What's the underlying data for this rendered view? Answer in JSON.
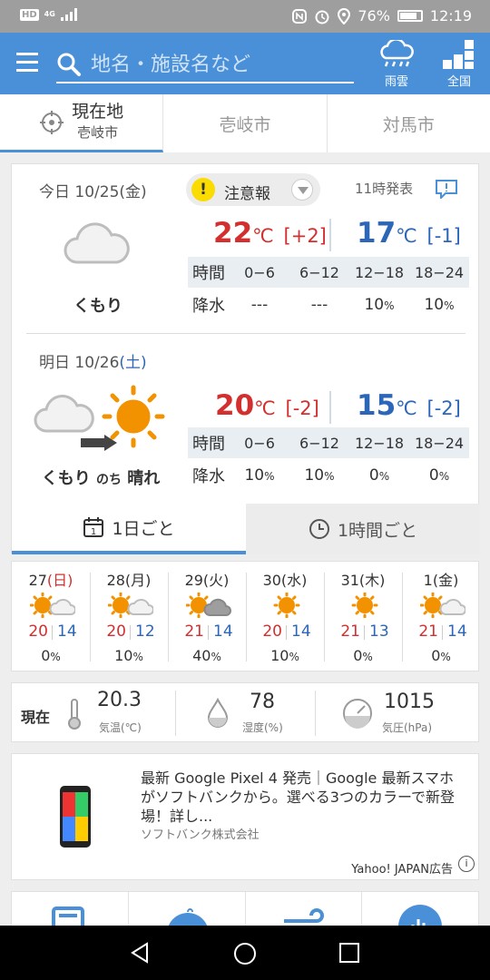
{
  "status_bar": {
    "network": "4G",
    "battery_percent": "76%",
    "time": "12:19"
  },
  "app_bar": {
    "search_placeholder": "地名・施設名など",
    "rain_cloud_label": "雨雲",
    "nationwide_label": "全国"
  },
  "location_tabs": [
    {
      "label": "現在地",
      "sub": "壱岐市"
    },
    {
      "label": "壱岐市"
    },
    {
      "label": "対馬市"
    }
  ],
  "today": {
    "label": "今日 10/25",
    "weekday": "(金)",
    "warning": "注意報",
    "issued": "11時発表",
    "condition": "くもり",
    "high": "22",
    "high_diff": "[+2]",
    "low": "17",
    "low_diff": "[-1]",
    "rain_header": [
      "時間",
      "0−6",
      "6−12",
      "12−18",
      "18−24"
    ],
    "rain_label": "降水",
    "rain": [
      "---",
      "---",
      "10",
      "10"
    ]
  },
  "tomorrow": {
    "label": "明日 10/26",
    "weekday": "(土)",
    "condition_a": "くもり",
    "condition_mid": "のち",
    "condition_b": "晴れ",
    "high": "20",
    "high_diff": "[-2]",
    "low": "15",
    "low_diff": "[-2]",
    "rain_header": [
      "時間",
      "0−6",
      "6−12",
      "12−18",
      "18−24"
    ],
    "rain_label": "降水",
    "rain": [
      "10",
      "10",
      "0",
      "0"
    ]
  },
  "units": {
    "celsius": "℃",
    "percent": "%"
  },
  "view_tabs": {
    "daily": "1日ごと",
    "hourly": "1時間ごと"
  },
  "week": [
    {
      "day": "27",
      "wd": "(日)",
      "icon": "sun-cloud-icon",
      "hi": "20",
      "lo": "14",
      "rain": "0"
    },
    {
      "day": "28",
      "wd": "(月)",
      "icon": "sun-cloud-icon",
      "hi": "20",
      "lo": "12",
      "rain": "10"
    },
    {
      "day": "29",
      "wd": "(火)",
      "icon": "sun-darkcloud-icon",
      "hi": "21",
      "lo": "14",
      "rain": "40"
    },
    {
      "day": "30",
      "wd": "(水)",
      "icon": "sun-icon",
      "hi": "20",
      "lo": "14",
      "rain": "10"
    },
    {
      "day": "31",
      "wd": "(木)",
      "icon": "sun-icon",
      "hi": "21",
      "lo": "13",
      "rain": "0"
    },
    {
      "day": "1",
      "wd": "(金)",
      "icon": "sun-cloud-icon",
      "hi": "21",
      "lo": "14",
      "rain": "0"
    }
  ],
  "current": {
    "label": "現在",
    "temp": "20.3",
    "temp_unit": "気温(℃)",
    "humidity": "78",
    "humidity_unit": "湿度(%)",
    "pressure": "1015",
    "pressure_unit": "気圧(hPa)"
  },
  "ad": {
    "text": "最新 Google Pixel 4 発売｜Google 最新スマホがソフトバンクから。選べる3つのカラーで新登場！詳し...",
    "sponsor": "ソフトバンク株式会社",
    "label": "Yahoo! JAPAN広告"
  },
  "colors": {
    "accent": "#4a90d9",
    "high": "#d32f2f",
    "low": "#2c66b8",
    "warning": "#fadc00",
    "sun": "#f39200"
  }
}
